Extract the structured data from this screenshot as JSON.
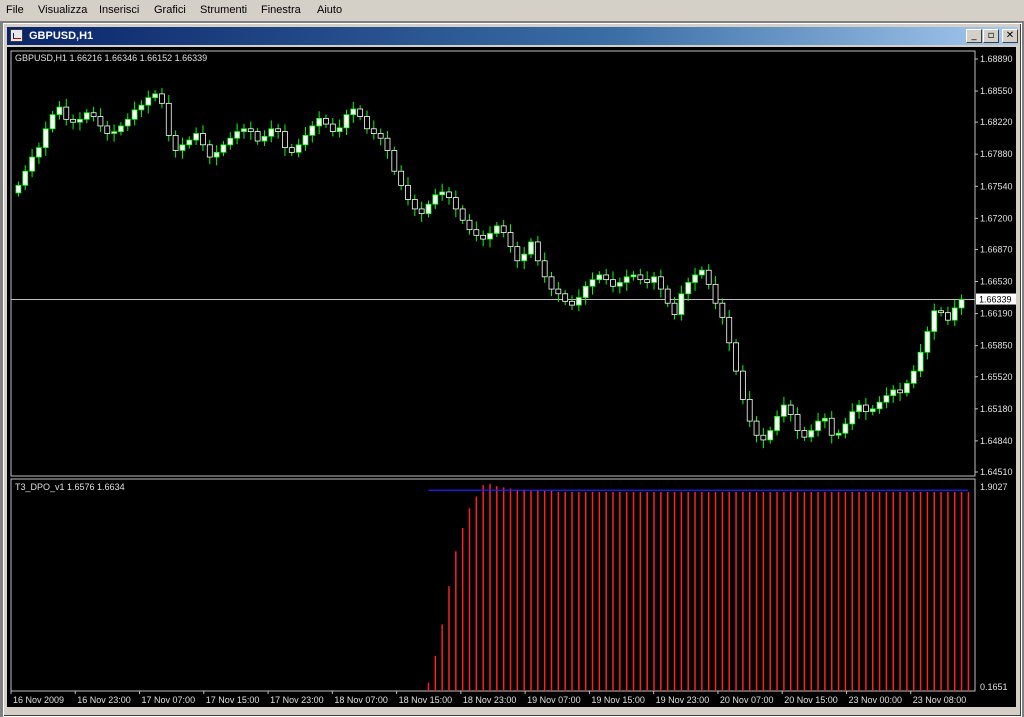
{
  "menu": [
    "File",
    "Visualizza",
    "Inserisci",
    "Grafici",
    "Strumenti",
    "Finestra",
    "Aiuto"
  ],
  "window": {
    "title": "GBPUSD,H1",
    "minimize_glyph": "_",
    "restore_glyph": "▫",
    "close_glyph": "✕"
  },
  "colors": {
    "background": "#000000",
    "candle_bull": "#ffffff",
    "candle_bear": "#ffffff",
    "wick": "#00ff00",
    "price_line": "#c0c0c0",
    "indicator_bars": "#ff2020",
    "indicator_line": "#2020ff",
    "axis_text": "#e0e0e0"
  },
  "chart_data": [
    {
      "type": "candlestick",
      "symbol_label": "GBPUSD,H1  1.66216  1.66346  1.66152  1.66339",
      "last_price_label": "1.66339",
      "last_price": 1.66339,
      "y_ticks": [
        "1.68890",
        "1.68550",
        "1.68220",
        "1.67880",
        "1.67540",
        "1.67200",
        "1.66870",
        "1.66530",
        "1.66190",
        "1.65850",
        "1.65520",
        "1.65180",
        "1.64840",
        "1.64510"
      ],
      "ylim": [
        1.6451,
        1.6889
      ],
      "closes": [
        1.6755,
        1.677,
        1.6785,
        1.6795,
        1.6815,
        1.683,
        1.6838,
        1.6825,
        1.6822,
        1.6825,
        1.6832,
        1.6828,
        1.6818,
        1.681,
        1.6812,
        1.6818,
        1.6825,
        1.6835,
        1.684,
        1.6848,
        1.6852,
        1.6842,
        1.6808,
        1.6792,
        1.6798,
        1.6803,
        1.681,
        1.6798,
        1.6785,
        1.679,
        1.6798,
        1.6805,
        1.6812,
        1.6815,
        1.6812,
        1.6802,
        1.6807,
        1.6815,
        1.6812,
        1.6795,
        1.679,
        1.6798,
        1.6808,
        1.6818,
        1.6826,
        1.682,
        1.6812,
        1.6816,
        1.683,
        1.6836,
        1.6828,
        1.6815,
        1.681,
        1.6805,
        1.6792,
        1.677,
        1.6755,
        1.674,
        1.673,
        1.6725,
        1.6735,
        1.6745,
        1.6748,
        1.6742,
        1.673,
        1.6718,
        1.6708,
        1.6702,
        1.6698,
        1.6704,
        1.6712,
        1.6705,
        1.669,
        1.6675,
        1.6682,
        1.6695,
        1.6675,
        1.6658,
        1.6645,
        1.664,
        1.6632,
        1.6628,
        1.6636,
        1.6648,
        1.6655,
        1.666,
        1.6655,
        1.6648,
        1.6652,
        1.6658,
        1.666,
        1.6655,
        1.6652,
        1.6658,
        1.6645,
        1.663,
        1.6618,
        1.664,
        1.6652,
        1.666,
        1.6665,
        1.665,
        1.663,
        1.6615,
        1.6588,
        1.6558,
        1.6528,
        1.6505,
        1.649,
        1.6485,
        1.6495,
        1.651,
        1.6522,
        1.6512,
        1.6495,
        1.6488,
        1.6495,
        1.6505,
        1.6508,
        1.649,
        1.6492,
        1.6502,
        1.6515,
        1.6522,
        1.6515,
        1.6518,
        1.6525,
        1.6532,
        1.6538,
        1.6535,
        1.6545,
        1.6558,
        1.6578,
        1.66,
        1.6622,
        1.662,
        1.6612,
        1.6625,
        1.6634
      ]
    },
    {
      "type": "bar",
      "indicator_label": "T3_DPO_v1  1.6576  1.6634",
      "y_ticks": [
        "1.9027",
        "0.1651"
      ],
      "ylim": [
        0.1651,
        1.9027
      ],
      "bars_start_index": 60,
      "bars": [
        0.22,
        0.45,
        0.72,
        1.05,
        1.35,
        1.55,
        1.72,
        1.82,
        1.92,
        1.93,
        1.91,
        1.9,
        1.89,
        1.88,
        1.88,
        1.87,
        1.87,
        1.87,
        1.87,
        1.86,
        1.86,
        1.86,
        1.86,
        1.86,
        1.86,
        1.86,
        1.86,
        1.86,
        1.86,
        1.86,
        1.86,
        1.86,
        1.86,
        1.86,
        1.86,
        1.86,
        1.86,
        1.86,
        1.86,
        1.86,
        1.86,
        1.86,
        1.86,
        1.86,
        1.86,
        1.86,
        1.86,
        1.86,
        1.86,
        1.86,
        1.86,
        1.86,
        1.86,
        1.86,
        1.86,
        1.86,
        1.86,
        1.86,
        1.86,
        1.86,
        1.86,
        1.86,
        1.86,
        1.86,
        1.86,
        1.86,
        1.86,
        1.86,
        1.86,
        1.86,
        1.86,
        1.86,
        1.86,
        1.86,
        1.86,
        1.86,
        1.86,
        1.86,
        1.86,
        1.86
      ],
      "line_value": 1.875
    }
  ],
  "x_axis_labels": [
    "16 Nov 2009",
    "16 Nov 23:00",
    "17 Nov 07:00",
    "17 Nov 15:00",
    "17 Nov 23:00",
    "18 Nov 07:00",
    "18 Nov 15:00",
    "18 Nov 23:00",
    "19 Nov 07:00",
    "19 Nov 15:00",
    "19 Nov 23:00",
    "20 Nov 07:00",
    "20 Nov 15:00",
    "23 Nov 00:00",
    "23 Nov 08:00"
  ]
}
